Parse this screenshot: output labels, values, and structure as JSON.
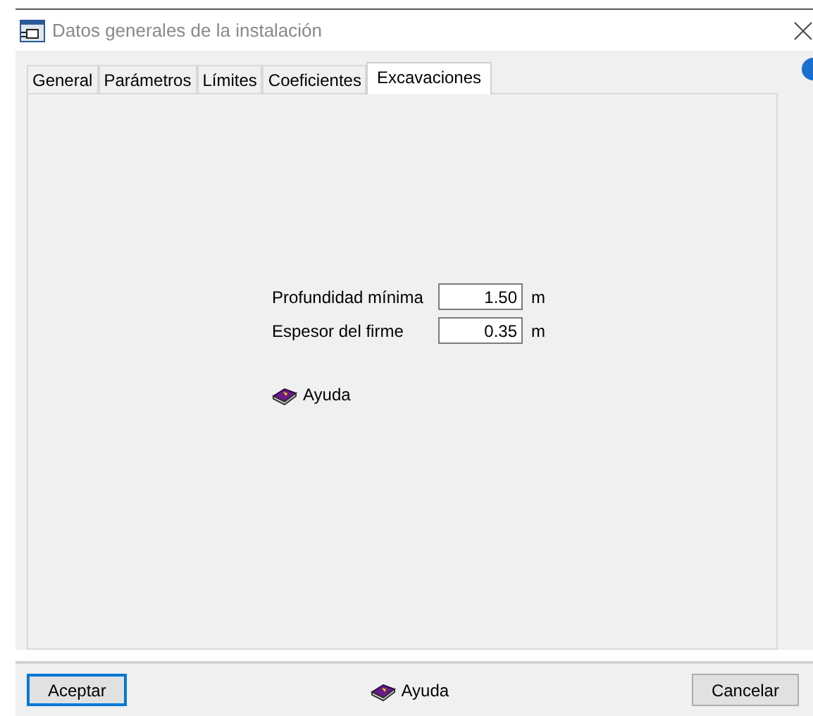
{
  "window": {
    "title": "Datos generales de la instalación"
  },
  "tabs": [
    {
      "label": "General",
      "selected": false
    },
    {
      "label": "Parámetros",
      "selected": false
    },
    {
      "label": "Límites",
      "selected": false
    },
    {
      "label": "Coeficientes",
      "selected": false
    },
    {
      "label": "Excavaciones",
      "selected": true
    }
  ],
  "fields": [
    {
      "label": "Profundidad mínima",
      "value": "1.50",
      "unit": "m"
    },
    {
      "label": "Espesor del firme",
      "value": "0.35",
      "unit": "m"
    }
  ],
  "panel_help": {
    "label": "Ayuda"
  },
  "footer": {
    "ok": {
      "label": "Aceptar",
      "focused": true
    },
    "help": {
      "label": "Ayuda"
    },
    "cancel": {
      "label": "Cancelar",
      "focused": false
    }
  }
}
